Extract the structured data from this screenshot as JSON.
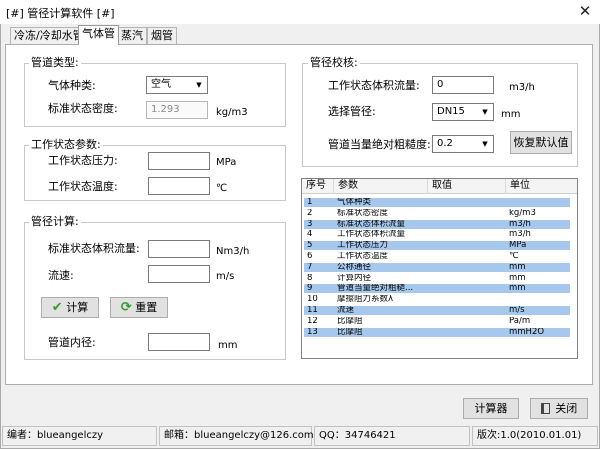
{
  "window": {
    "title": "[#] 管径计算软件 [#]",
    "close_glyph": "✕"
  },
  "tabs": [
    {
      "label": "冷冻/冷却水管",
      "active": false
    },
    {
      "label": "气体管",
      "active": true
    },
    {
      "label": "蒸汽",
      "active": false
    },
    {
      "label": "烟管",
      "active": false
    }
  ],
  "pipe_type": {
    "legend": "管道类型:",
    "gas_kind_label": "气体种类:",
    "gas_kind_value": "空气",
    "std_density_label": "标准状态密度:",
    "std_density_value": "1.293",
    "std_density_unit": "kg/m3"
  },
  "work_params": {
    "legend": "工作状态参数:",
    "pressure_label": "工作状态压力:",
    "pressure_value": "",
    "pressure_unit": "MPa",
    "temperature_label": "工作状态温度:",
    "temperature_value": "",
    "temperature_unit": "℃"
  },
  "pipe_calc": {
    "legend": "管径计算:",
    "std_flow_label": "标准状态体积流量:",
    "std_flow_value": "",
    "std_flow_unit": "Nm3/h",
    "velocity_label": "流速:",
    "velocity_value": "",
    "velocity_unit": "m/s",
    "calc_button": "计算",
    "reset_button": "重置",
    "inner_diameter_label": "管道内径:",
    "inner_diameter_value": "",
    "inner_diameter_unit": "mm"
  },
  "pipe_check": {
    "legend": "管径校核:",
    "work_flow_label": "工作状态体积流量:",
    "work_flow_value": "0",
    "work_flow_unit": "m3/h",
    "select_pipe_label": "选择管径:",
    "select_pipe_value": "DN15",
    "select_pipe_unit": "mm",
    "roughness_label": "管道当量绝对粗糙度:",
    "roughness_value": "0.2",
    "restore_default_button": "恢复默认值"
  },
  "result_table": {
    "columns": [
      "序号",
      "参数",
      "取值",
      "单位"
    ],
    "rows": [
      {
        "no": "1",
        "param": "气体种类",
        "value": "",
        "unit": "",
        "hl": true
      },
      {
        "no": "2",
        "param": "标准状态密度",
        "value": "",
        "unit": "kg/m3",
        "hl": false
      },
      {
        "no": "3",
        "param": "标准状态体积流量",
        "value": "",
        "unit": "m3/h",
        "hl": true
      },
      {
        "no": "4",
        "param": "工作状态体积流量",
        "value": "",
        "unit": "m3/h",
        "hl": false
      },
      {
        "no": "5",
        "param": "工作状态压力",
        "value": "",
        "unit": "MPa",
        "hl": true
      },
      {
        "no": "6",
        "param": "工作状态温度",
        "value": "",
        "unit": "℃",
        "hl": false
      },
      {
        "no": "7",
        "param": "公称通径",
        "value": "",
        "unit": "mm",
        "hl": true
      },
      {
        "no": "8",
        "param": "计算内径",
        "value": "",
        "unit": "mm",
        "hl": false
      },
      {
        "no": "9",
        "param": "管道当量绝对粗糙...",
        "value": "",
        "unit": "mm",
        "hl": true
      },
      {
        "no": "10",
        "param": "摩擦阻力系数λ",
        "value": "",
        "unit": "",
        "hl": false
      },
      {
        "no": "11",
        "param": "流速",
        "value": "",
        "unit": "m/s",
        "hl": true
      },
      {
        "no": "12",
        "param": "比摩阻",
        "value": "",
        "unit": "Pa/m",
        "hl": false
      },
      {
        "no": "13",
        "param": "比摩阻",
        "value": "",
        "unit": "mmH2O",
        "hl": true
      }
    ]
  },
  "bottom_buttons": {
    "calculator": "计算器",
    "close": "关闭"
  },
  "status_bar": {
    "author": "编者：blueangelczy",
    "email": "邮箱：blueangelczy@126.com",
    "qq": "QQ：34746421",
    "version": "版次:1.0(2010.01.01)"
  },
  "colors": {
    "row_highlight": "#a6c8ec",
    "calc_icon": "#2f9b2f",
    "reset_icon": "#2f9b2f"
  }
}
